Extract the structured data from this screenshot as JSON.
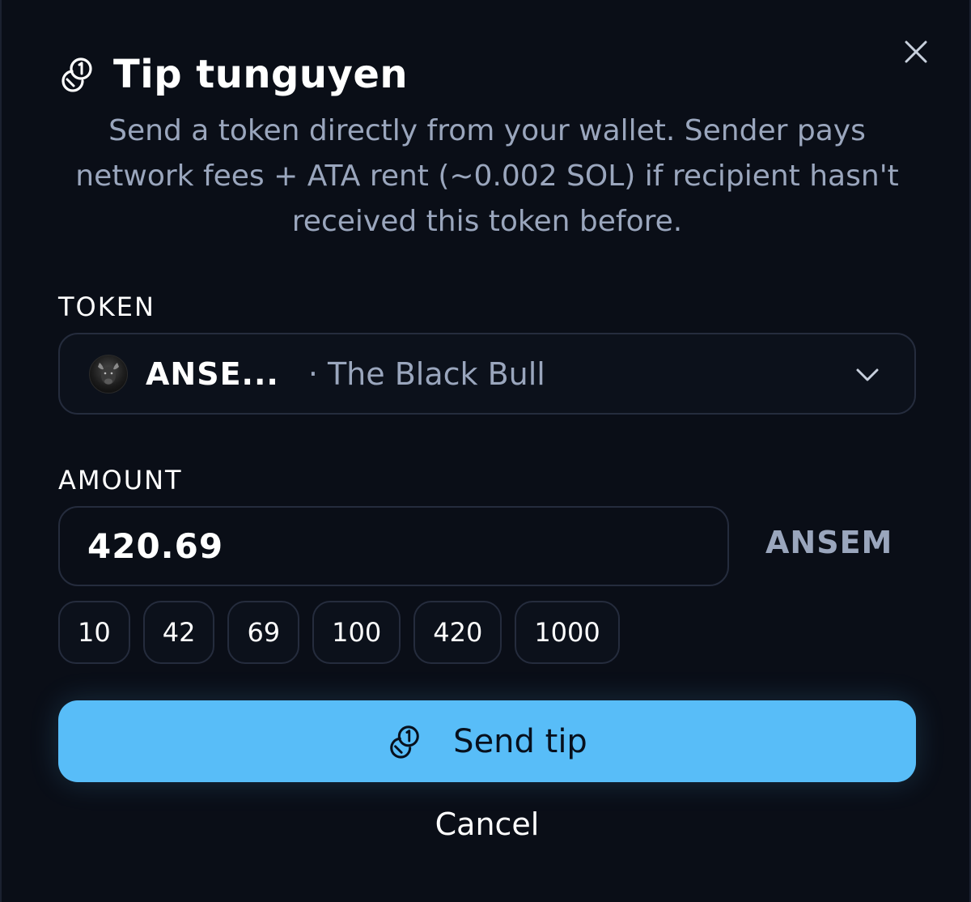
{
  "dialog": {
    "title": "Tip tunguyen",
    "description": "Send a token directly from your wallet. Sender pays network fees + ATA rent (~0.002 SOL) if recipient hasn't received this token before.",
    "close_icon": "close-icon",
    "title_icon": "coins-icon"
  },
  "token": {
    "label": "TOKEN",
    "symbol": "ANSE...",
    "separator": "·",
    "name": "The Black Bull",
    "avatar_icon": "black-bull-avatar"
  },
  "amount": {
    "label": "AMOUNT",
    "value": "420.69",
    "unit": "ANSEM",
    "presets": [
      "10",
      "42",
      "69",
      "100",
      "420",
      "1000"
    ]
  },
  "actions": {
    "send_label": "Send tip",
    "cancel_label": "Cancel"
  },
  "colors": {
    "background": "#0a0e17",
    "accent": "#58bdf8",
    "muted_text": "#9aa6bd",
    "border": "#252c3d"
  }
}
